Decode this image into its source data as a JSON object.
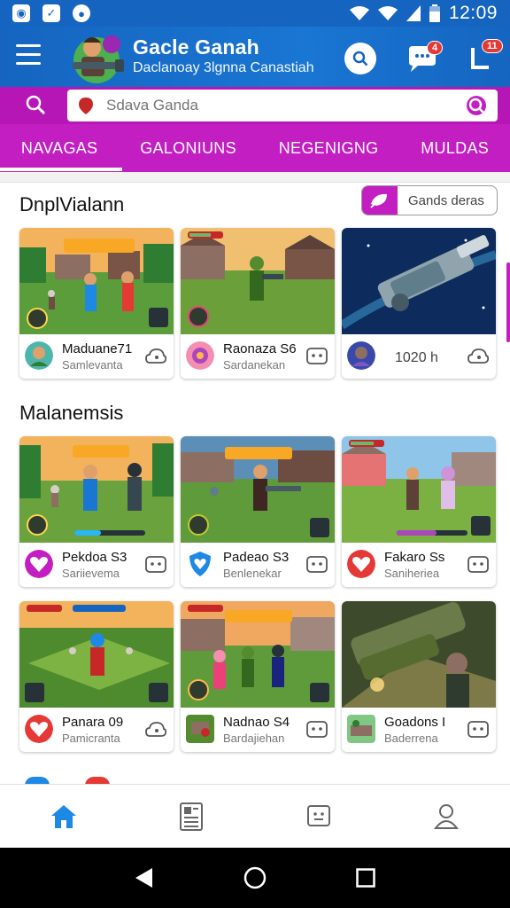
{
  "status_bar": {
    "time": "12:09"
  },
  "header": {
    "title": "Gacle Ganah",
    "subtitle": "Daclanoay 3lgnna Canastiah",
    "chat_badge": "4",
    "notif_badge": "11"
  },
  "search": {
    "placeholder": "Sdava Ganda"
  },
  "tabs": [
    {
      "label": "NAVAGAS"
    },
    {
      "label": "GALONIUNS"
    },
    {
      "label": "NEGENIGNG"
    },
    {
      "label": "MULDAS"
    }
  ],
  "sections": {
    "first": {
      "title": "DnplVialann",
      "filter_label": "Gands deras"
    },
    "second": {
      "title": "Malanemsis"
    }
  },
  "cards_row1": [
    {
      "name": "Maduane71",
      "sub": "Samlevanta"
    },
    {
      "name": "Raonaza S6",
      "sub": "Sardanekan"
    },
    {
      "name": "1020 h",
      "sub": ""
    }
  ],
  "cards_row2": [
    {
      "name": "Pekdoa S3",
      "sub": "Sariievema"
    },
    {
      "name": "Padeao S3",
      "sub": "Benlenekar"
    },
    {
      "name": "Fakaro Ss",
      "sub": "Saniheriea"
    }
  ],
  "cards_row3": [
    {
      "name": "Panara 09",
      "sub": "Pamicranta"
    },
    {
      "name": "Nadnao S4",
      "sub": "Bardajiehan"
    },
    {
      "name": "Goadons I",
      "sub": "Baderrena"
    }
  ],
  "colors": {
    "primary": "#1565c0",
    "accent": "#c21ec2",
    "home_active": "#1e88e5"
  }
}
